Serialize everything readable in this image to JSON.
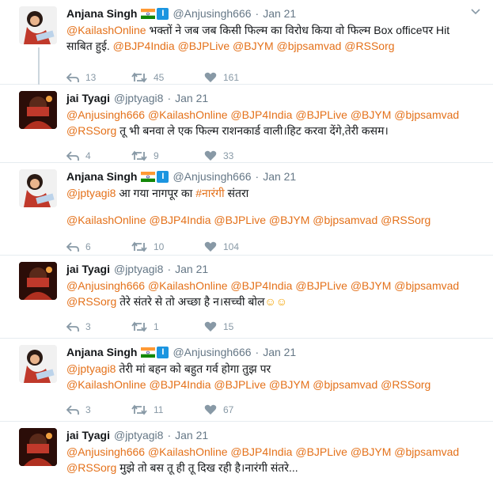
{
  "tweets": [
    {
      "name": "Anjana Singh",
      "handle": "@Anjusingh666",
      "time": "Jan 21",
      "line1_mention": "@KailashOnline",
      "line1_text": " भक्तों ने जब जब किसी फिल्म का विरोध किया वो फिल्म Box officeपर Hit",
      "line2_text": "साबित हुई. ",
      "line2_mentions": "@BJP4India @BJPLive @BJYM @bjpsamvad @RSSorg",
      "replies": "13",
      "retweets": "45",
      "likes": "161"
    },
    {
      "name": "jai Tyagi",
      "handle": "@jptyagi8",
      "time": "Jan 21",
      "line1_mentions": "@Anjusingh666 @KailashOnline @BJP4India @BJPLive @BJYM @bjpsamvad",
      "line2_mention": "@RSSorg",
      "line2_text": " तू भी बनवा ले एक फिल्म राशनकार्ड वाली।हिट करवा देंगे,तेरी कसम।",
      "replies": "4",
      "retweets": "9",
      "likes": "33"
    },
    {
      "name": "Anjana Singh",
      "handle": "@Anjusingh666",
      "time": "Jan 21",
      "line1_mention": "@jptyagi8",
      "line1_text": " आ गया नागपूर का ",
      "line1_hashtag": "#नारंगी",
      "line1_tail": " संतरा",
      "line2_mentions": "@KailashOnline @BJP4India @BJPLive @BJYM @bjpsamvad @RSSorg",
      "replies": "6",
      "retweets": "10",
      "likes": "104"
    },
    {
      "name": "jai Tyagi",
      "handle": "@jptyagi8",
      "time": "Jan 21",
      "line1_mentions": "@Anjusingh666 @KailashOnline @BJP4India @BJPLive @BJYM @bjpsamvad",
      "line2_mention": "@RSSorg",
      "line2_text": " तेरे संतरे से तो अच्छा है न।सच्ची बोल",
      "line2_emoji": "☺☺",
      "replies": "3",
      "retweets": "1",
      "likes": "15"
    },
    {
      "name": "Anjana Singh",
      "handle": "@Anjusingh666",
      "time": "Jan 21",
      "line1_mention": "@jptyagi8",
      "line1_text": " तेरी मां बहन को बहुत गर्व होगा तुझ पर",
      "line2_mentions": "@KailashOnline @BJP4India @BJPLive @BJYM @bjpsamvad @RSSorg",
      "replies": "3",
      "retweets": "11",
      "likes": "67"
    },
    {
      "name": "jai Tyagi",
      "handle": "@jptyagi8",
      "time": "Jan 21",
      "line1_mentions": "@Anjusingh666 @KailashOnline @BJP4India @BJPLive @BJYM @bjpsamvad",
      "line2_mention": "@RSSorg",
      "line2_text": " मुझे तो बस तू ही तू दिख रही है।नारंगी संतरे..."
    }
  ],
  "colors": {
    "link": "#e4711a",
    "muted": "#8899a6",
    "verified": "#1b95e0"
  },
  "icons": {
    "reply": "reply-icon",
    "retweet": "retweet-icon",
    "like": "heart-icon",
    "more": "chevron-down-icon",
    "flag": "india-flag-icon"
  }
}
